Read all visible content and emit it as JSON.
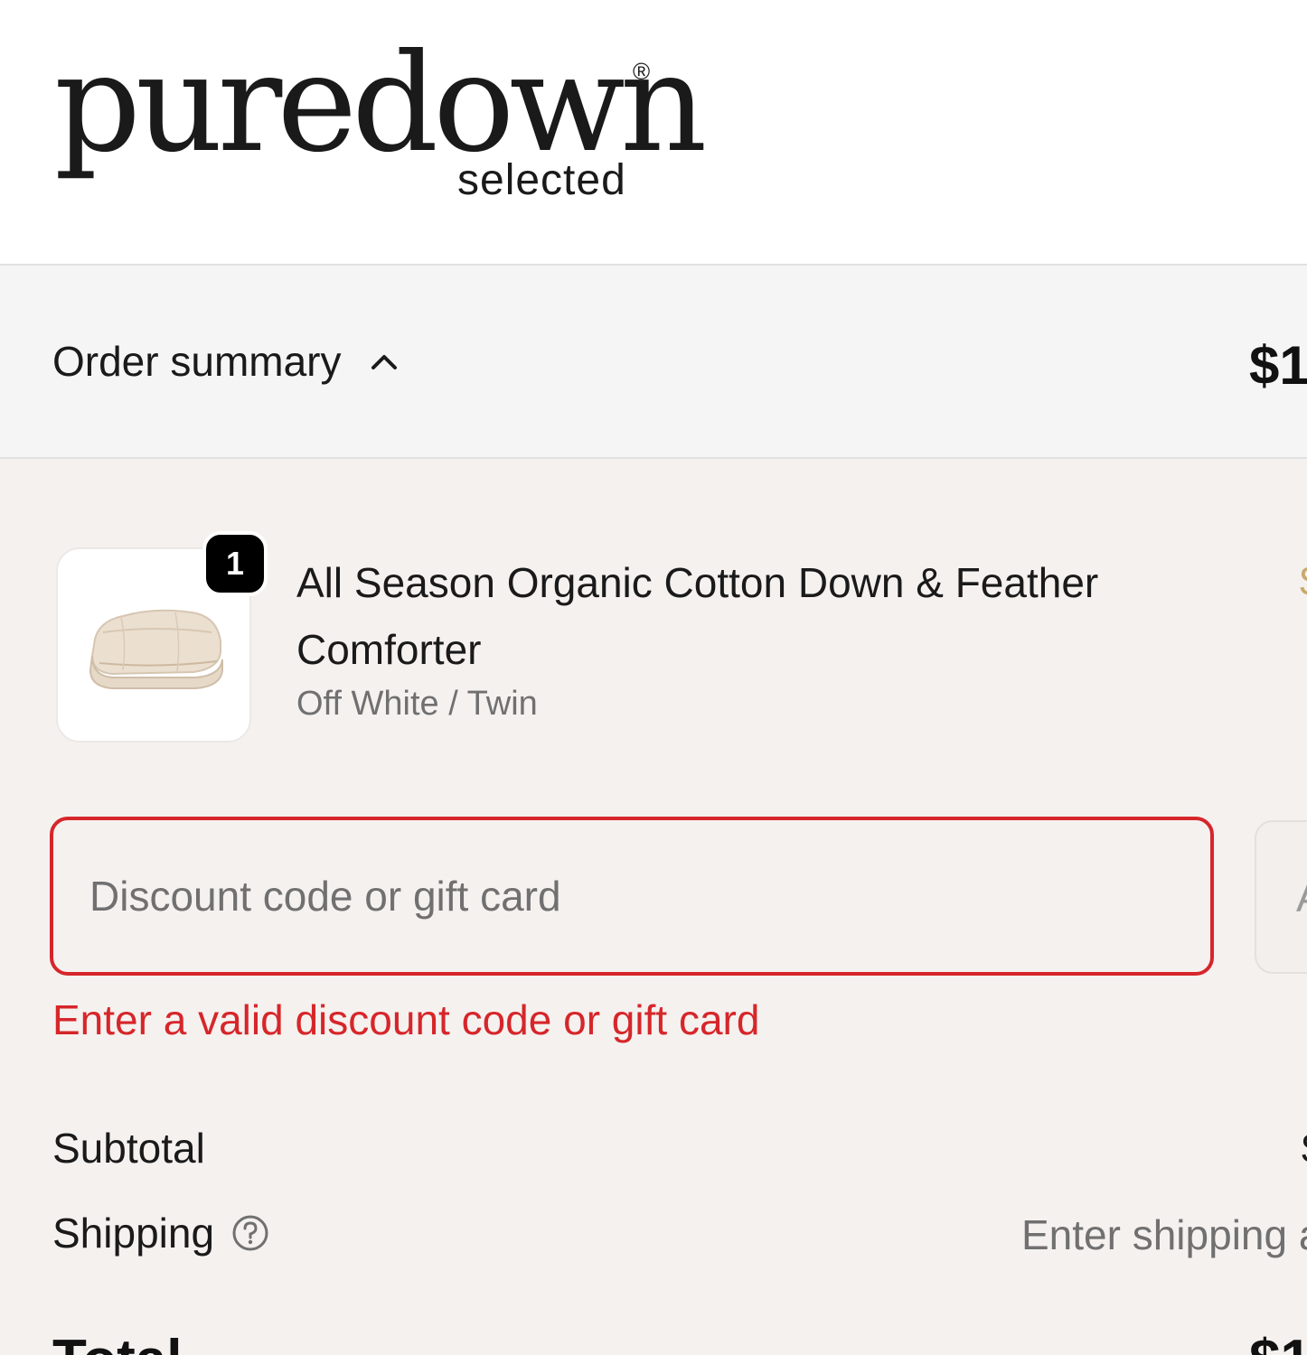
{
  "brand": {
    "wordmark": "puredown",
    "registered_mark": "®",
    "tagline": "selected"
  },
  "order_summary": {
    "label": "Order summary",
    "toggle_icon": "chevron-up-icon",
    "total_visible": "$1"
  },
  "line_item": {
    "quantity": "1",
    "name": "All Season Organic Cotton Down & Feather Comforter",
    "variant": "Off White / Twin",
    "price_visible": "$"
  },
  "discount": {
    "placeholder": "Discount code or gift card",
    "value": "",
    "apply_label": "A",
    "error": "Enter a valid discount code or gift card"
  },
  "totals": {
    "subtotal_label": "Subtotal",
    "subtotal_value": "$",
    "shipping_label": "Shipping",
    "shipping_help_icon": "question-circle-icon",
    "shipping_value": "Enter shipping address",
    "total_label": "Total",
    "total_value": "$1"
  },
  "colors": {
    "error": "#d6262a",
    "summary_bar_bg": "#f5f5f5",
    "panel_bg": "#f5f1ef",
    "badge_bg": "#000000"
  }
}
